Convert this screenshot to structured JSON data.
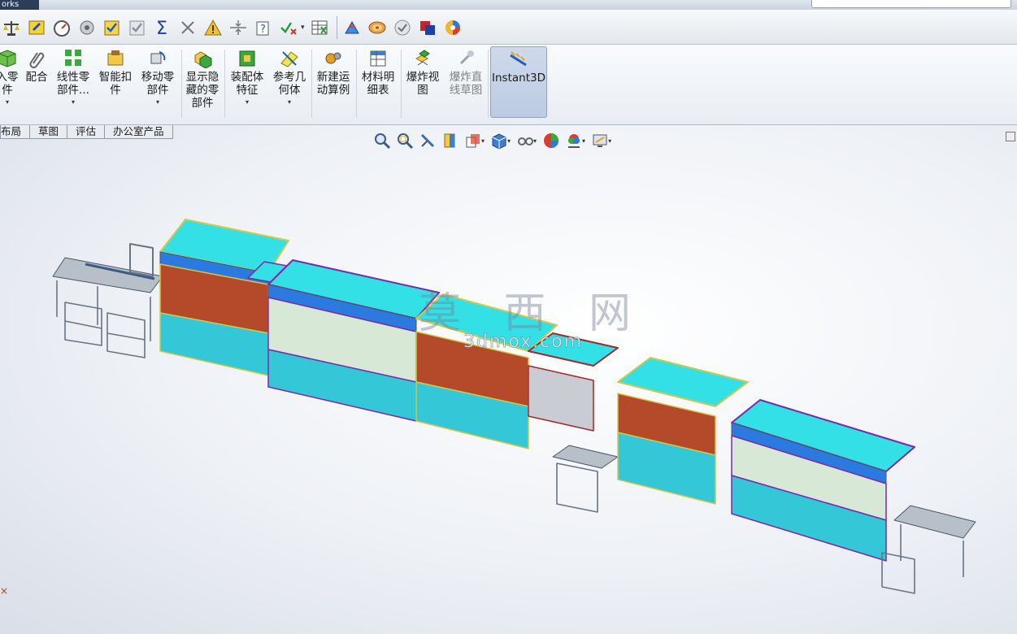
{
  "titlebar": {
    "app_fragment": "orks"
  },
  "toolbar": {
    "icons": [
      "balance-icon",
      "edit-icon",
      "gauge-icon",
      "gear-circle-icon",
      "check-box-icon",
      "check-box-gray-icon",
      "sigma-icon",
      "scissors-icon",
      "warning-icon",
      "split-icon",
      "help-doc-icon",
      "check-x-icon",
      "table-icon",
      "component-spark-icon",
      "target-icon",
      "gray-check-icon",
      "two-squares-icon",
      "color-wheel-icon"
    ]
  },
  "ribbon": {
    "buttons": [
      {
        "label": "入零\n件",
        "dropdown": true
      },
      {
        "label": "配合",
        "dropdown": false
      },
      {
        "label": "线性零\n部件...",
        "dropdown": true
      },
      {
        "label": "智能扣\n件",
        "dropdown": false
      },
      {
        "label": "移动零\n部件",
        "dropdown": true
      },
      {
        "label": "显示隐\n藏的零\n部件",
        "dropdown": false
      },
      {
        "label": "装配体\n特征",
        "dropdown": true
      },
      {
        "label": "参考几\n何体",
        "dropdown": true
      },
      {
        "label": "新建运\n动算例",
        "dropdown": false
      },
      {
        "label": "材料明\n细表",
        "dropdown": false
      },
      {
        "label": "爆炸视\n图",
        "dropdown": false
      },
      {
        "label": "爆炸直\n线草图",
        "dropdown": false
      },
      {
        "label": "Instant3D",
        "dropdown": false
      }
    ]
  },
  "tabs": [
    "布局",
    "草图",
    "评估",
    "办公室产品"
  ],
  "headsup": {
    "icons": [
      "zoom-fit-icon",
      "zoom-area-icon",
      "previous-view-icon",
      "section-view-icon",
      "view-orientation-icon",
      "display-style-icon",
      "hide-show-icon",
      "appearance-icon",
      "scene-icon",
      "view-settings-icon"
    ]
  },
  "watermark": {
    "cn": "莫 西 网",
    "url": "3dmox.com"
  },
  "colors": {
    "cabinet_top": "#33e0e6",
    "cabinet_band": "#2a7ae0",
    "frame_purple": "#7a2aa6",
    "frame_yellow": "#d2c84a",
    "interior_red": "#b44a2a",
    "ribbon_active": "#bccbe2"
  }
}
